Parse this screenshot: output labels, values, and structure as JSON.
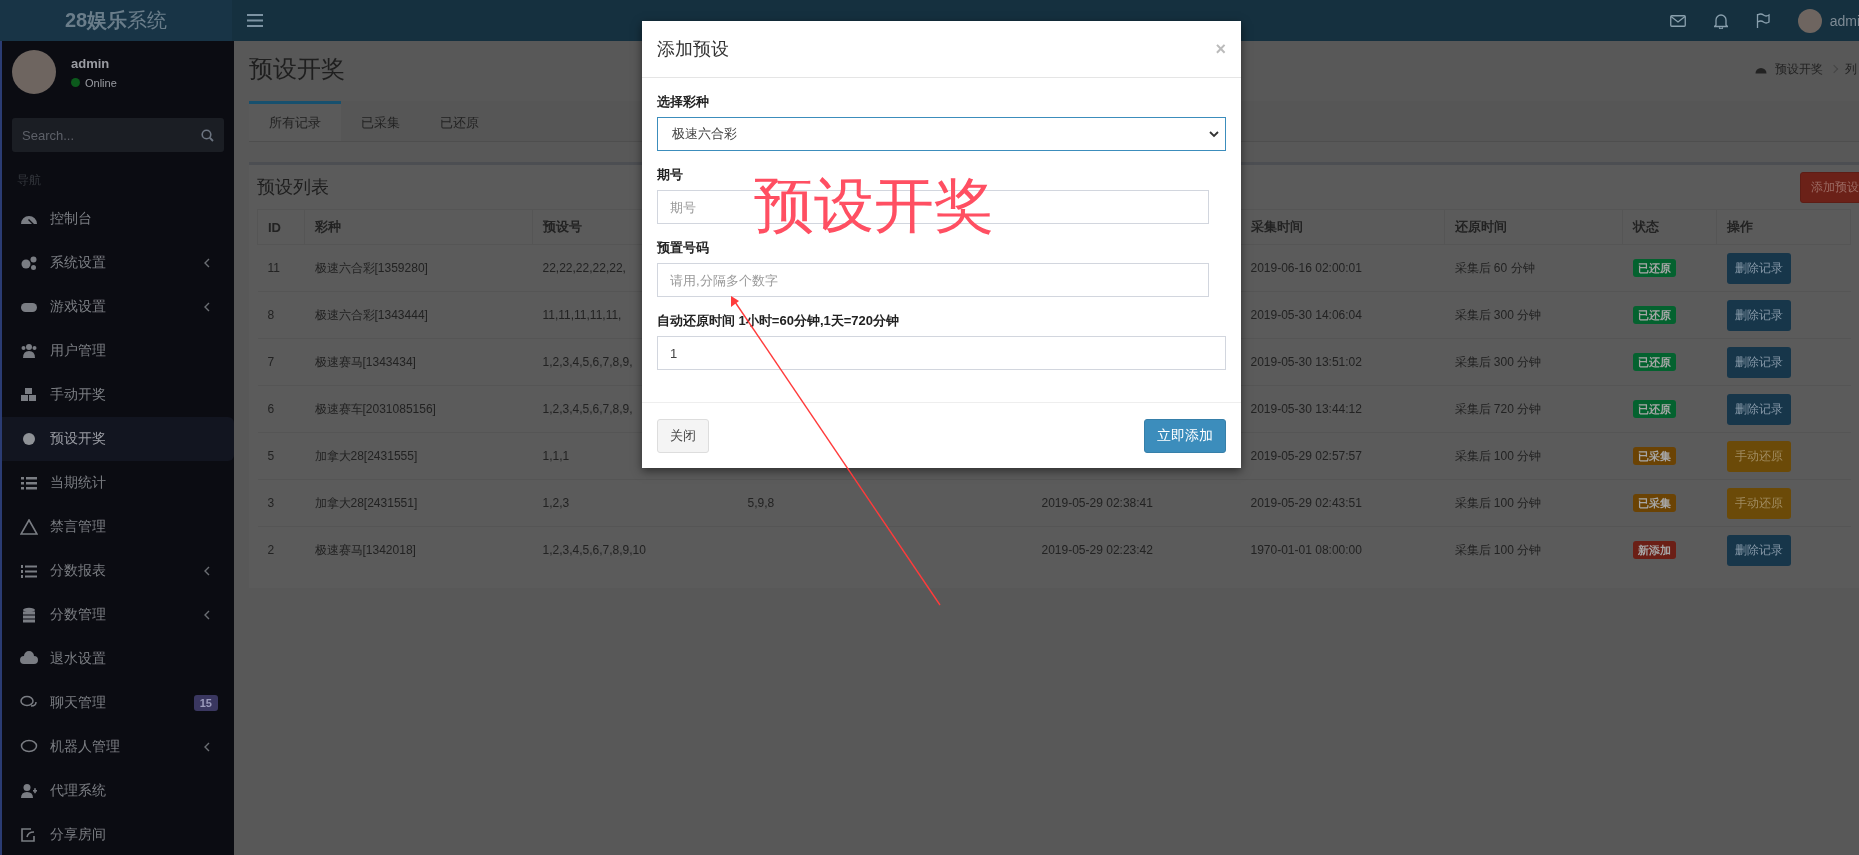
{
  "brand": {
    "logo": "**28娱乐**系统"
  },
  "topbar": {
    "user_name": "admi"
  },
  "user_panel": {
    "name": "admin",
    "status": "Online"
  },
  "sidebar": {
    "search": {
      "placeholder": "Search..."
    },
    "header": "导航",
    "items": [
      {
        "label": "控制台",
        "has_children": false,
        "selected": false
      },
      {
        "label": "系统设置",
        "has_children": true,
        "selected": false
      },
      {
        "label": "游戏设置",
        "has_children": true,
        "selected": false
      },
      {
        "label": "用户管理",
        "has_children": false,
        "selected": false
      },
      {
        "label": "手动开奖",
        "has_children": false,
        "selected": false
      },
      {
        "label": "预设开奖",
        "has_children": false,
        "selected": true
      },
      {
        "label": "当期统计",
        "has_children": false,
        "selected": false
      },
      {
        "label": "禁言管理",
        "has_children": false,
        "selected": false
      },
      {
        "label": "分数报表",
        "has_children": true,
        "selected": false
      },
      {
        "label": "分数管理",
        "has_children": true,
        "selected": false
      },
      {
        "label": "退水设置",
        "has_children": false,
        "selected": false
      },
      {
        "label": "聊天管理",
        "has_children": false,
        "selected": false,
        "badge": "15"
      },
      {
        "label": "机器人管理",
        "has_children": true,
        "selected": false
      },
      {
        "label": "代理系统",
        "has_children": false,
        "selected": false
      },
      {
        "label": "分享房间",
        "has_children": false,
        "selected": false
      }
    ]
  },
  "page": {
    "title": "预设开奖",
    "breadcrumb": [
      "预设开奖",
      "列"
    ]
  },
  "tabs": [
    {
      "label": "所有记录",
      "selected": true
    },
    {
      "label": "已采集",
      "selected": false
    },
    {
      "label": "已还原",
      "selected": false
    }
  ],
  "box": {
    "title": "预设列表",
    "add_button": "添加预设"
  },
  "table": {
    "columns": [
      "ID",
      "彩种",
      "预设号",
      null,
      null,
      "采集时间",
      "还原时间",
      "状态",
      "操作"
    ],
    "rows": [
      {
        "cells": [
          "11",
          "极速六合彩[1359280]",
          "22,22,22,22,22,",
          null,
          null,
          "2019-06-16 02:00:01",
          "采集后 60 分钟"
        ],
        "status": {
          "label": "已还原",
          "color": "#04622f"
        },
        "action": {
          "label": "删除记录",
          "kind": "delete"
        }
      },
      {
        "cells": [
          "8",
          "极速六合彩[1343444]",
          "11,11,11,11,11,",
          null,
          null,
          "2019-05-30 14:06:04",
          "采集后 300 分钟"
        ],
        "status": {
          "label": "已还原",
          "color": "#04622f"
        },
        "action": {
          "label": "删除记录",
          "kind": "delete"
        }
      },
      {
        "cells": [
          "7",
          "极速赛马[1343434]",
          "1,2,3,4,5,6,7,8,9,",
          null,
          null,
          "2019-05-30 13:51:02",
          "采集后 300 分钟"
        ],
        "status": {
          "label": "已还原",
          "color": "#04622f"
        },
        "action": {
          "label": "删除记录",
          "kind": "delete"
        }
      },
      {
        "cells": [
          "6",
          "极速赛车[2031085156]",
          "1,2,3,4,5,6,7,8,9,",
          null,
          null,
          "2019-05-30 13:44:12",
          "采集后 720 分钟"
        ],
        "status": {
          "label": "已还原",
          "color": "#04622f"
        },
        "action": {
          "label": "删除记录",
          "kind": "delete"
        }
      },
      {
        "cells": [
          "5",
          "加拿大28[2431555]",
          "1,1,1",
          null,
          null,
          "2019-05-29 02:57:57",
          "采集后 100 分钟"
        ],
        "status": {
          "label": "已采集",
          "color": "#6b4304"
        },
        "action": {
          "label": "手动还原",
          "kind": "restore"
        }
      },
      {
        "cells": [
          "3",
          "加拿大28[2431551]",
          "1,2,3",
          "5,9,8",
          "2019-05-29 02:38:41",
          "2019-05-29 02:43:51",
          "采集后 100 分钟"
        ],
        "status": {
          "label": "已采集",
          "color": "#6b4304"
        },
        "action": {
          "label": "手动还原",
          "kind": "restore"
        }
      },
      {
        "cells": [
          "2",
          "极速赛马[1342018]",
          "1,2,3,4,5,6,7,8,9,10",
          null,
          "2019-05-29 02:23:42",
          "1970-01-01 08:00:00",
          "采集后 100 分钟"
        ],
        "status": {
          "label": "新添加",
          "color": "#6b1f16"
        },
        "action": {
          "label": "删除记录",
          "kind": "delete"
        }
      }
    ]
  },
  "modal": {
    "title": "添加预设",
    "close": "×",
    "fields": [
      {
        "kind": "select",
        "label": "选择彩种",
        "value": "极速六合彩",
        "focused": true
      },
      {
        "kind": "input",
        "label": "期号",
        "placeholder": "期号",
        "focused": false
      },
      {
        "kind": "input",
        "label": "预置号码",
        "placeholder": "请用,分隔多个数字",
        "focused": false
      },
      {
        "kind": "wide_input",
        "label": "自动还原时间 1小时=60分钟,1天=720分钟",
        "value": "1",
        "focused": false
      }
    ],
    "buttons": [
      {
        "label": "关闭",
        "kind": "default"
      },
      {
        "label": "立即添加",
        "kind": "primary"
      }
    ]
  },
  "annotation": {
    "text": "预设开奖"
  }
}
